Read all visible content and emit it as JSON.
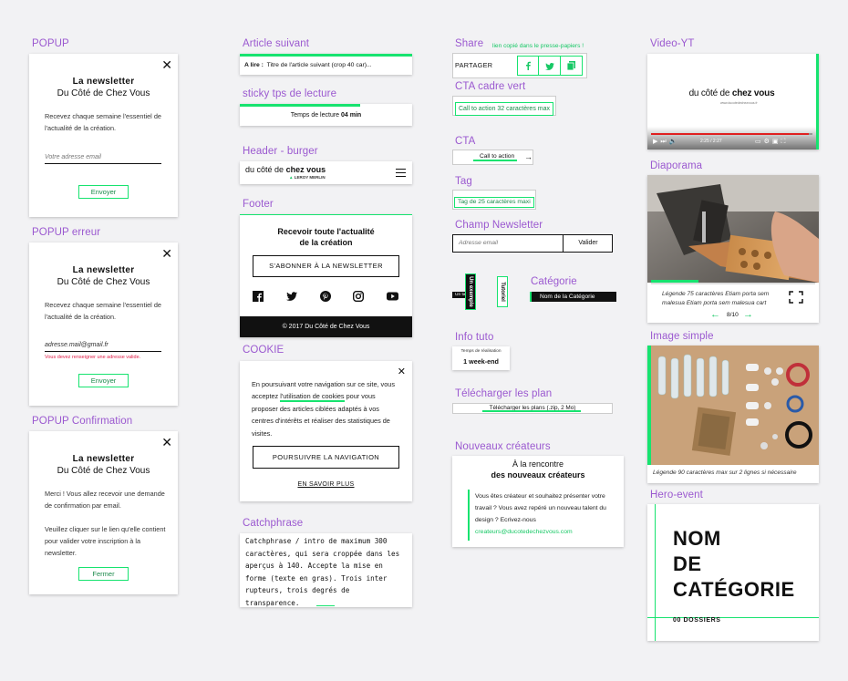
{
  "colors": {
    "accent": "#17e36f",
    "label": "#9b59d0",
    "dark": "#111111"
  },
  "col1": {
    "popup": {
      "section_label": "POPUP",
      "title_line1": "La newsletter",
      "title_line2": "Du Côté de Chez Vous",
      "text": "Recevez chaque semaine l'essentiel de l'actualité de la création.",
      "email_placeholder": "Votre adresse email",
      "submit_label": "Envoyer"
    },
    "popup_error": {
      "section_label": "POPUP erreur",
      "title_line1": "La newsletter",
      "title_line2": "Du Côté de Chez Vous",
      "text": "Recevez chaque semaine l'essentiel de l'actualité de la création.",
      "email_value": "adresse.mail@gmail.fr",
      "error_text": "Vous devez renseigner une adresse valide.",
      "submit_label": "Envoyer"
    },
    "popup_confirm": {
      "section_label": "POPUP Confirmation",
      "title_line1": "La newsletter",
      "title_line2": "Du Côté de Chez Vous",
      "text1": "Merci ! Vous allez recevoir une demande de confirmation par email.",
      "text2": "Veuillez cliquer sur le lien qu'elle contient pour valider votre inscription à la newsletter.",
      "close_label": "Fermer"
    }
  },
  "col2": {
    "article_suivant": {
      "section_label": "Article suivant",
      "prefix": "A lire :",
      "title": "Titre de l'article suivant (crop 40 car)..."
    },
    "sticky": {
      "section_label": "sticky tps de lecture",
      "text_prefix": "Temps de lecture",
      "value": "04 min",
      "progress": 0.7
    },
    "header": {
      "section_label": "Header - burger",
      "logo_light": "du côté de",
      "logo_bold": "chez vous",
      "brand": "LEROY MERLIN"
    },
    "footer": {
      "section_label": "Footer",
      "title_line1": "Recevoir toute l'actualité",
      "title_line2": "de la création",
      "subscribe_label": "S'ABONNER À LA NEWSLETTER",
      "social": [
        "facebook-icon",
        "twitter-icon",
        "pinterest-icon",
        "instagram-icon",
        "youtube-icon"
      ],
      "copyright": "© 2017 Du Côté de Chez Vous"
    },
    "cookie": {
      "section_label": "COOKIE",
      "text_before": "En poursuivant votre navigation sur ce site, vous acceptez ",
      "link": "l'utilisation de cookies",
      "text_after": " pour vous proposer des articles ciblées adaptés à vos centres d'intérêts et réaliser des statistiques de visites.",
      "continue_label": "POURSUIVRE LA NAVIGATION",
      "more_label": "EN SAVOIR PLUS"
    },
    "catchphrase": {
      "section_label": "Catchphrase",
      "text": "Catchphrase / intro de maximum 300 caractères, qui sera croppée dans les aperçus à 140. Accepte la mise en forme (texte en gras). Trois inter rupteurs, trois degrés de transparence."
    }
  },
  "col3": {
    "share": {
      "section_label": "Share",
      "copied": "lien copié dans le presse-papiers !",
      "label": "PARTAGER"
    },
    "cta_frame": {
      "section_label": "CTA cadre vert",
      "label": "Call to action 32 caractères max"
    },
    "cta": {
      "section_label": "CTA",
      "label": "Call to action"
    },
    "tag": {
      "section_label": "Tag",
      "label": "Tag de 25 caractères maxi"
    },
    "newsletter": {
      "section_label": "Champ Newsletter",
      "placeholder": "Adresse email",
      "submit": "Valider"
    },
    "rotated_tags": {
      "small": "Un tag",
      "v1": "Un exemple",
      "v2": "Tutoriel"
    },
    "category": {
      "section_label": "Catégorie",
      "label": "Nom de la Catégorie"
    },
    "info_tuto": {
      "section_label": "Info tuto",
      "small": "Temps de réalisation",
      "value": "1 week-end"
    },
    "download": {
      "section_label": "Télécharger les plan",
      "label": "Télécharger les plans (.zip, 2 Mo)"
    },
    "creators": {
      "section_label": "Nouveaux créateurs",
      "title_line1": "À la rencontre",
      "title_line2": "des nouveaux créateurs",
      "text": "Vous êtes créateur et souhaitez présenter votre travail ? Vous avez repéré un nouveau talent du design ? Ecrivez-nous",
      "email": "createurs@ducotedechezvous.com"
    }
  },
  "col4": {
    "video": {
      "section_label": "Video-YT",
      "logo_light": "du côté de",
      "logo_bold": "chez vous",
      "url": "www.ducotedechezvous.fr",
      "time": "2:25 / 2:27",
      "progress": 0.98
    },
    "diaporama": {
      "section_label": "Diaporama",
      "legend": "Légende 75 caractères Etiam porta sem malesua Etiam porta sem malesua cart",
      "counter": "8/10"
    },
    "image_simple": {
      "section_label": "Image simple",
      "legend": "Légende 90 caractères max sur 2 lignes si nécessaire"
    },
    "hero": {
      "section_label": "Hero-event",
      "line1": "NOM",
      "line2": "DE",
      "line3": "CATÉGORIE",
      "count": "00 DOSSIERS"
    }
  }
}
